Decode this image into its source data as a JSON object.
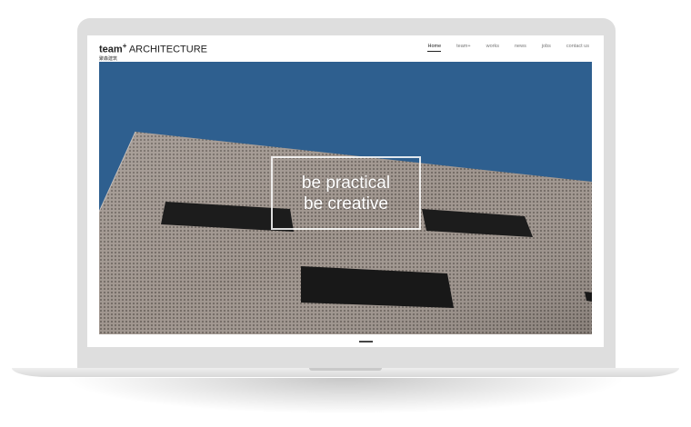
{
  "logo": {
    "brand": "team",
    "mark": "+",
    "suffix": "ARCHITECTURE",
    "subtitle": "聚森建筑"
  },
  "nav": {
    "items": [
      {
        "label": "Home",
        "active": true
      },
      {
        "label": "team+",
        "active": false
      },
      {
        "label": "works",
        "active": false
      },
      {
        "label": "news",
        "active": false
      },
      {
        "label": "jobs",
        "active": false
      },
      {
        "label": "contact us",
        "active": false
      }
    ]
  },
  "hero": {
    "tagline_line1": "be practical",
    "tagline_line2": "be creative",
    "sky_color": "#2e5f8f",
    "facade_color": "#9a908a"
  },
  "slider": {
    "active_slide": 1
  }
}
